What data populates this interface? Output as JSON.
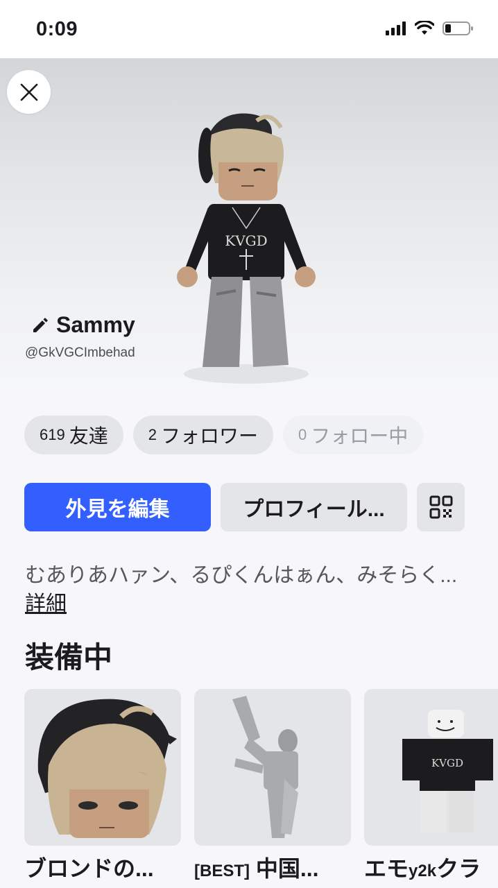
{
  "status_bar": {
    "time": "0:09"
  },
  "profile": {
    "display_name": "Sammy",
    "username": "@GkVGCImbehad"
  },
  "stats": [
    {
      "count": "619",
      "label": "友達"
    },
    {
      "count": "2",
      "label": "フォロワー"
    },
    {
      "count": "0",
      "label": "フォロー中"
    }
  ],
  "actions": {
    "edit_avatar": "外見を編集",
    "profile": "プロフィール..."
  },
  "bio": {
    "text": "むありあハァン、るぴくんはぁん、みそらく...",
    "more": "詳細"
  },
  "equipped": {
    "title": "装備中",
    "items": [
      {
        "name": "ブロンドの..."
      },
      {
        "prefix": "[BEST]",
        "name": " 中国..."
      },
      {
        "name": "エモ",
        "small": "y2k",
        "name2": "クラ"
      }
    ]
  },
  "colors": {
    "primary": "#335fff",
    "pill": "#e4e5e9",
    "text": "#1b1b1f"
  },
  "icons": [
    "close-icon",
    "pencil-icon",
    "qr-code-icon",
    "signal-icon",
    "wifi-icon",
    "battery-icon"
  ]
}
